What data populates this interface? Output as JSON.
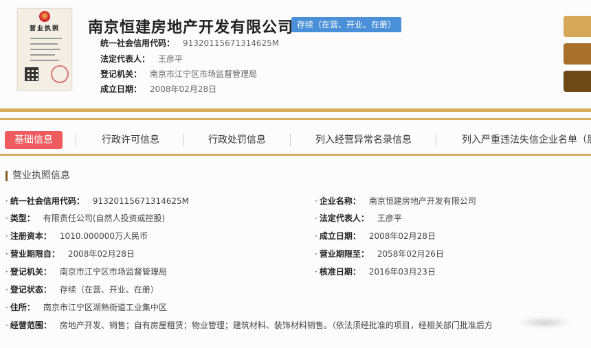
{
  "header": {
    "license_thumb_title": "营业执照",
    "company_name": "南京恒建房地产开发有限公司",
    "status": "存续（在营、开业、在册）",
    "meta": [
      {
        "label": "统一社会信用代码：",
        "value": "91320115671314625M"
      },
      {
        "label": "法定代表人：",
        "value": "王彦平"
      },
      {
        "label": "登记机关：",
        "value": "南京市江宁区市场监督管理局"
      },
      {
        "label": "成立日期：",
        "value": "2008年02月28日"
      }
    ],
    "side_button_colors": [
      "#d6a95a",
      "#a8702a",
      "#6e4a17"
    ]
  },
  "tabs": [
    {
      "label": "基础信息",
      "active": true
    },
    {
      "label": "行政许可信息",
      "active": false
    },
    {
      "label": "行政处罚信息",
      "active": false
    },
    {
      "label": "列入经营异常名录信息",
      "active": false
    },
    {
      "label": "列入严重违法失信企业名单（黑",
      "active": false
    }
  ],
  "section": {
    "title": "营业执照信息",
    "bullet": "·",
    "fields": [
      {
        "label": "统一社会信用代码：",
        "value": "91320115671314625M"
      },
      {
        "label": "企业名称：",
        "value": "南京恒建房地产开发有限公司"
      },
      {
        "label": "类型：",
        "value": "有限责任公司(自然人投资或控股)"
      },
      {
        "label": "法定代表人：",
        "value": "王彦平"
      },
      {
        "label": "注册资本：",
        "value": "1010.000000万人民币"
      },
      {
        "label": "成立日期：",
        "value": "2008年02月28日"
      },
      {
        "label": "营业期限自：",
        "value": "2008年02月28日"
      },
      {
        "label": "营业期限至：",
        "value": "2058年02月26日"
      },
      {
        "label": "登记机关：",
        "value": "南京市江宁区市场监督管理局"
      },
      {
        "label": "核准日期：",
        "value": "2016年03月23日"
      },
      {
        "label": "登记状态：",
        "value": "存续（在营、开业、在册）"
      },
      {
        "label": "住所：",
        "value": "南京市江宁区湖熟街道工业集中区"
      },
      {
        "label": "经营范围：",
        "value": "房地产开发、销售；自有房屋租赁；物业管理；建筑材料、装饰材料销售。（依法须经批准的项目，经相关部门批准后方"
      }
    ]
  },
  "colors": {
    "accent_gold": "#d6ad5b",
    "active_tab": "#ee5c5f",
    "status_badge": "#4a90d9"
  }
}
